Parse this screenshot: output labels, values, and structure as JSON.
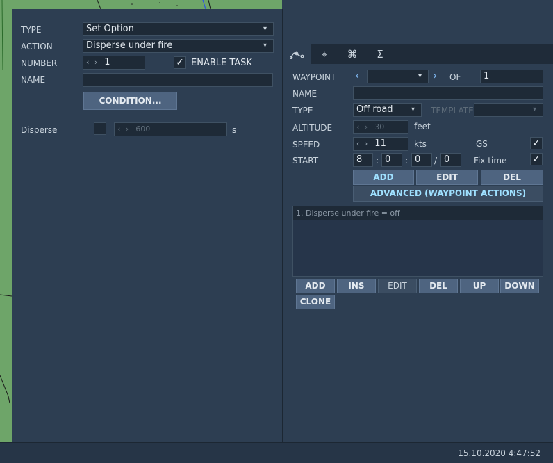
{
  "left": {
    "type_label": "TYPE",
    "type_value": "Set Option",
    "action_label": "ACTION",
    "action_value": "Disperse under fire",
    "number_label": "NUMBER",
    "number_value": "1",
    "enable_task_label": "ENABLE TASK",
    "enable_task_checked": true,
    "name_label": "NAME",
    "name_value": "",
    "condition_button": "CONDITION...",
    "disperse_label": "Disperse",
    "disperse_checked": false,
    "disperse_value": "600",
    "disperse_unit": "s"
  },
  "right": {
    "tabs": [
      {
        "icon": "route-icon",
        "glyph": "⌒"
      },
      {
        "icon": "target-icon",
        "glyph": "⌖"
      },
      {
        "icon": "command-icon",
        "glyph": "⌘"
      },
      {
        "icon": "sigma-icon",
        "glyph": "Σ"
      }
    ],
    "waypoint_label": "WAYPOINT",
    "waypoint_value": "",
    "of_label": "OF",
    "of_value": "1",
    "name_label": "NAME",
    "name_value": "",
    "type_label": "TYPE",
    "type_value": "Off road",
    "template_label": "TEMPLATE",
    "template_value": "",
    "altitude_label": "ALTITUDE",
    "altitude_value": "30",
    "altitude_unit": "feet",
    "speed_label": "SPEED",
    "speed_value": "11",
    "speed_unit": "kts",
    "gs_label": "GS",
    "gs_checked": true,
    "start_label": "START",
    "start_h": "8",
    "start_m": "0",
    "start_s": "0",
    "start_f": "0",
    "fix_time_label": "Fix time",
    "fix_time_checked": true,
    "add_button": "ADD",
    "edit_button": "EDIT",
    "del_button": "DEL",
    "advanced_button": "ADVANCED (WAYPOINT ACTIONS)",
    "actions": [
      "1. Disperse under fire = off"
    ],
    "list_buttons": {
      "add": "ADD",
      "ins": "INS",
      "edit": "EDIT",
      "del": "DEL",
      "up": "UP",
      "down": "DOWN",
      "clone": "CLONE"
    }
  },
  "status": {
    "datetime": "15.10.2020 4:47:52"
  },
  "colors": {
    "panel_bg": "#2d3e52",
    "field_bg": "#1e2a37",
    "button_bg": "#4e6480",
    "accent_cyan": "#9fe0ff",
    "nav_arrow": "#7fb7f0",
    "map_green": "#6ea569"
  }
}
